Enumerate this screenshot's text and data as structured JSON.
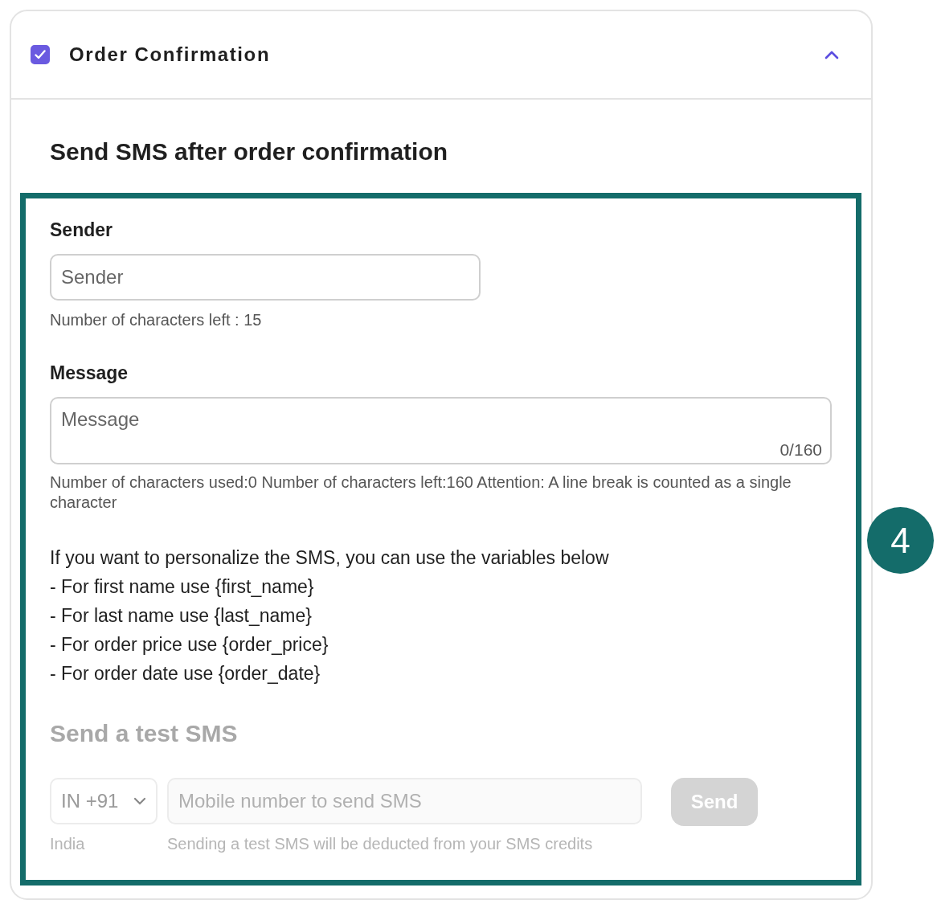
{
  "section": {
    "title": "Order Confirmation",
    "checked": true,
    "expanded": true
  },
  "heading": "Send SMS after order confirmation",
  "sender": {
    "label": "Sender",
    "placeholder": "Sender",
    "hint": "Number of characters left : 15"
  },
  "message": {
    "label": "Message",
    "placeholder": "Message",
    "counter": "0/160",
    "hint": "Number of characters used:0 Number of characters left:160 Attention: A line break is counted as a single character"
  },
  "variables": {
    "intro": "If you want to personalize the SMS, you can use the variables below",
    "lines": [
      "- For first name use {first_name}",
      "- For last name use {last_name}",
      "- For order price use {order_price}",
      "- For order date use {order_date}"
    ]
  },
  "test_sms": {
    "title": "Send a test SMS",
    "disabled": true,
    "country": {
      "value": "IN +91",
      "caption": "India"
    },
    "phone": {
      "placeholder": "Mobile number to send SMS",
      "hint": "Sending a test SMS will be deducted from your SMS credits"
    },
    "send_button": "Send"
  },
  "step_badge": "4"
}
